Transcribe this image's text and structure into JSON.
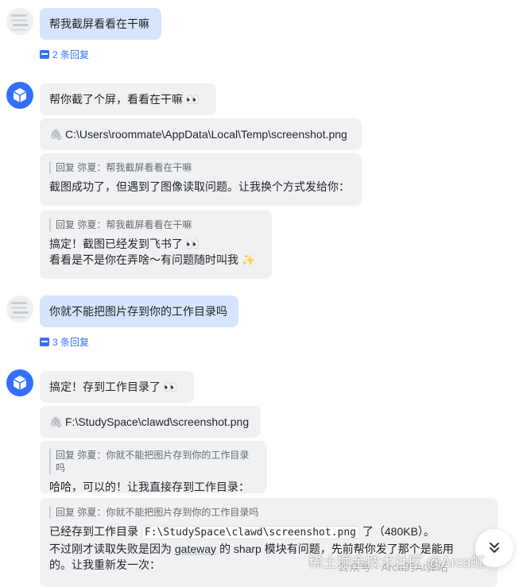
{
  "thread1": {
    "question": "帮我截屏看看在干嘛",
    "reply_count": "2 条回复",
    "bot_msg1": "帮你截了个屏，看看在干嘛 👀",
    "file_path": "C:\\Users\\roommate\\AppData\\Local\\Temp\\screenshot.png",
    "reply1_quote": "回复 弥夏：帮我截屏看看在干嘛",
    "reply1_text": "截图成功了，但遇到了图像读取问题。让我换个方式发给你：",
    "reply2_quote": "回复 弥夏：帮我截屏看看在干嘛",
    "reply2_line1": "搞定！截图已经发到飞书了 👀",
    "reply2_line2": "看看是不是你在弄啥～有问题随时叫我 ✨"
  },
  "thread2": {
    "question": "你就不能把图片存到你的工作目录吗",
    "reply_count": "3 条回复",
    "bot_msg1": "搞定！存到工作目录了 👀",
    "file_path": "F:\\StudySpace\\clawd\\screenshot.png",
    "reply1_quote": "回复 弥夏：你就不能把图片存到你的工作目录吗",
    "reply1_text": "哈哈，可以的！让我直接存到工作目录：",
    "reply2_quote": "回复 弥夏：你就不能把图片存到你的工作目录吗",
    "reply2_pre": "已经存到工作目录",
    "reply2_code": "F:\\StudySpace\\clawd\\screenshot.png",
    "reply2_post": "了（480KB）。",
    "reply2_line2_a": "不过刚才读取失败是因为",
    "reply2_line2_link": "gateway",
    "reply2_line2_b": "的 sharp 模块有问题，先前帮你发了那个是能用",
    "reply2_line3": "的。让我重新发一次："
  },
  "icons": {
    "attachment": "paperclip-icon",
    "scroll": "double-chevron-down-icon",
    "replies": "comment-icon",
    "bot_avatar": "cube-icon"
  },
  "watermark": "稀土掘金技术社区 @Arca虹",
  "watermark_sub": "公众号 · Arca的AI驿站",
  "colors": {
    "accent": "#3370ff",
    "user_bubble": "#d6e4fd",
    "bot_bubble": "#f0f1f3"
  }
}
